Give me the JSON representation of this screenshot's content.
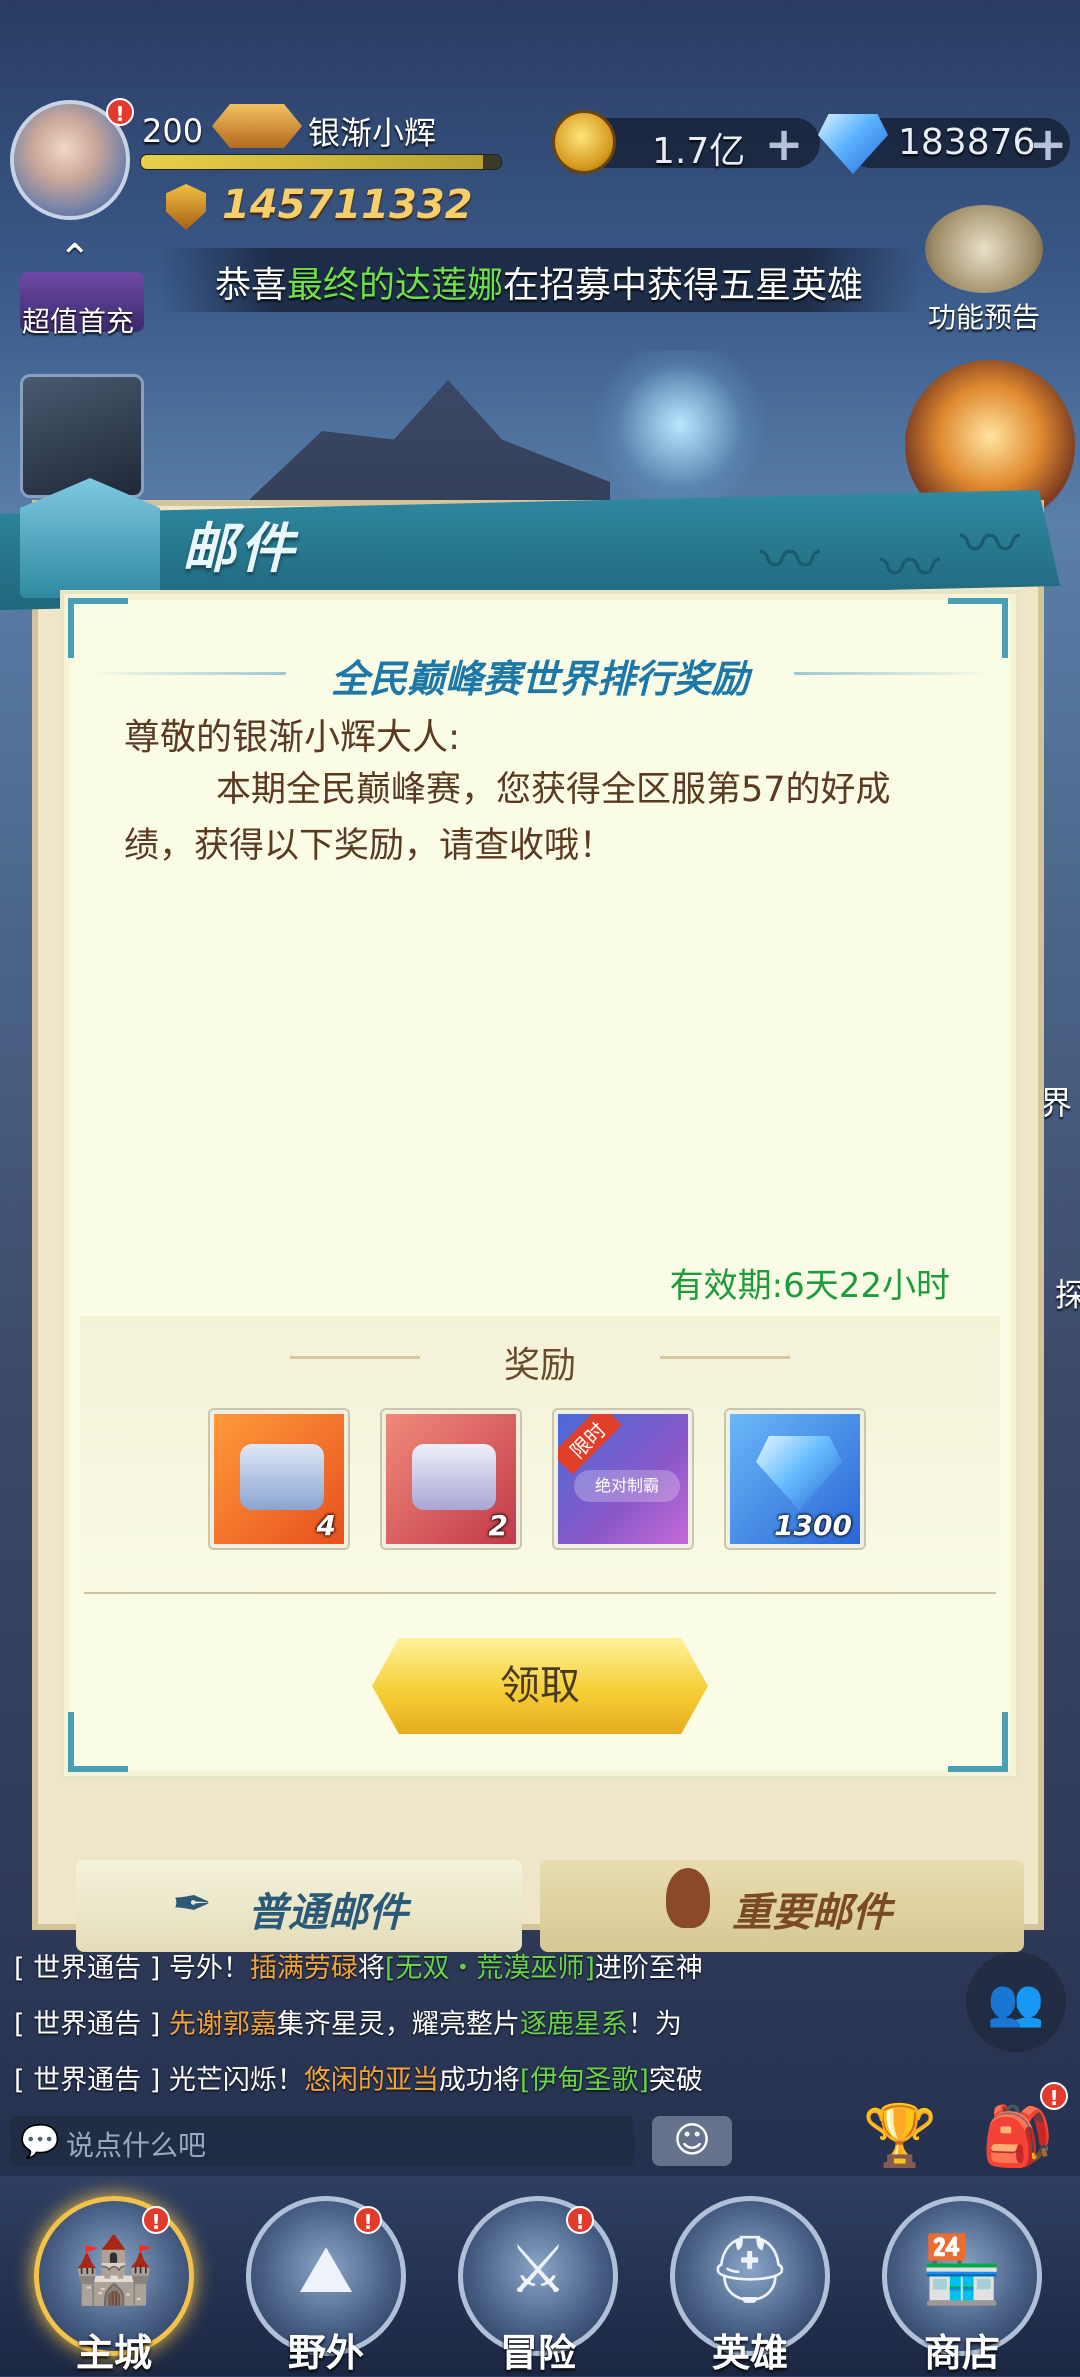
{
  "player": {
    "level": "200",
    "name": "银渐小辉",
    "xp_fraction": 0.95,
    "power": "145711332"
  },
  "resources": {
    "gold": "1.7亿",
    "gems": "183876",
    "plus": "+"
  },
  "announcement": {
    "prefix": "恭喜",
    "highlight": "最终的达莲娜",
    "suffix": "在招募中获得五星英雄"
  },
  "side": {
    "first_recharge": "超值首充",
    "feature_preview": "功能预告",
    "right_1": "界",
    "right_2": "探",
    "up_chevron": "⌃"
  },
  "mail": {
    "header": "邮件",
    "title": "全民巅峰赛世界排行奖励",
    "greeting": "尊敬的银渐小辉大人:",
    "body": "本期全民巅峰赛，您获得全区服第57的好成绩，获得以下奖励，请查收哦！",
    "expiry": "有效期:6天22小时",
    "reward_title": "奖励",
    "claim_button": "领取",
    "rewards": [
      {
        "icon": "orange-treasure-chest",
        "qty": "4"
      },
      {
        "icon": "red-treasure-chest",
        "qty": "2"
      },
      {
        "icon": "limited-frame",
        "qty": "",
        "tag": "限时",
        "caption": "绝对制霸"
      },
      {
        "icon": "diamond",
        "qty": "1300"
      }
    ]
  },
  "tabs": {
    "normal": "普通邮件",
    "important": "重要邮件"
  },
  "chat": {
    "tag": "[ 世界通告 ]",
    "line1": {
      "a": "号外！",
      "b": "插满劳碌",
      "c": "将",
      "d": "[无双・荒漠巫师]",
      "e": "进阶至神"
    },
    "line2": {
      "a": "先谢郭嘉",
      "b": "集齐星灵，耀亮整片",
      "c": "逐鹿星系",
      "d": "！为"
    },
    "line3": {
      "a": "光芒闪烁！",
      "b": "悠闲的亚当",
      "c": "成功将",
      "d": "[伊甸圣歌]",
      "e": "突破"
    },
    "placeholder": "说点什么吧"
  },
  "nav": [
    {
      "label": "主城",
      "glyph": "🏰",
      "badge": "!"
    },
    {
      "label": "野外",
      "glyph": "⛰",
      "badge": "!"
    },
    {
      "label": "冒险",
      "glyph": "⚔",
      "badge": "!"
    },
    {
      "label": "英雄",
      "glyph": "⛑",
      "badge": ""
    },
    {
      "label": "商店",
      "glyph": "🏪",
      "badge": ""
    }
  ],
  "badge_symbol": "!",
  "colors": {
    "accent_blue": "#1d78a8",
    "expiry_green": "#1e9b3a",
    "gold_button": "#f5cf37",
    "badge_red": "#e23a2b"
  }
}
